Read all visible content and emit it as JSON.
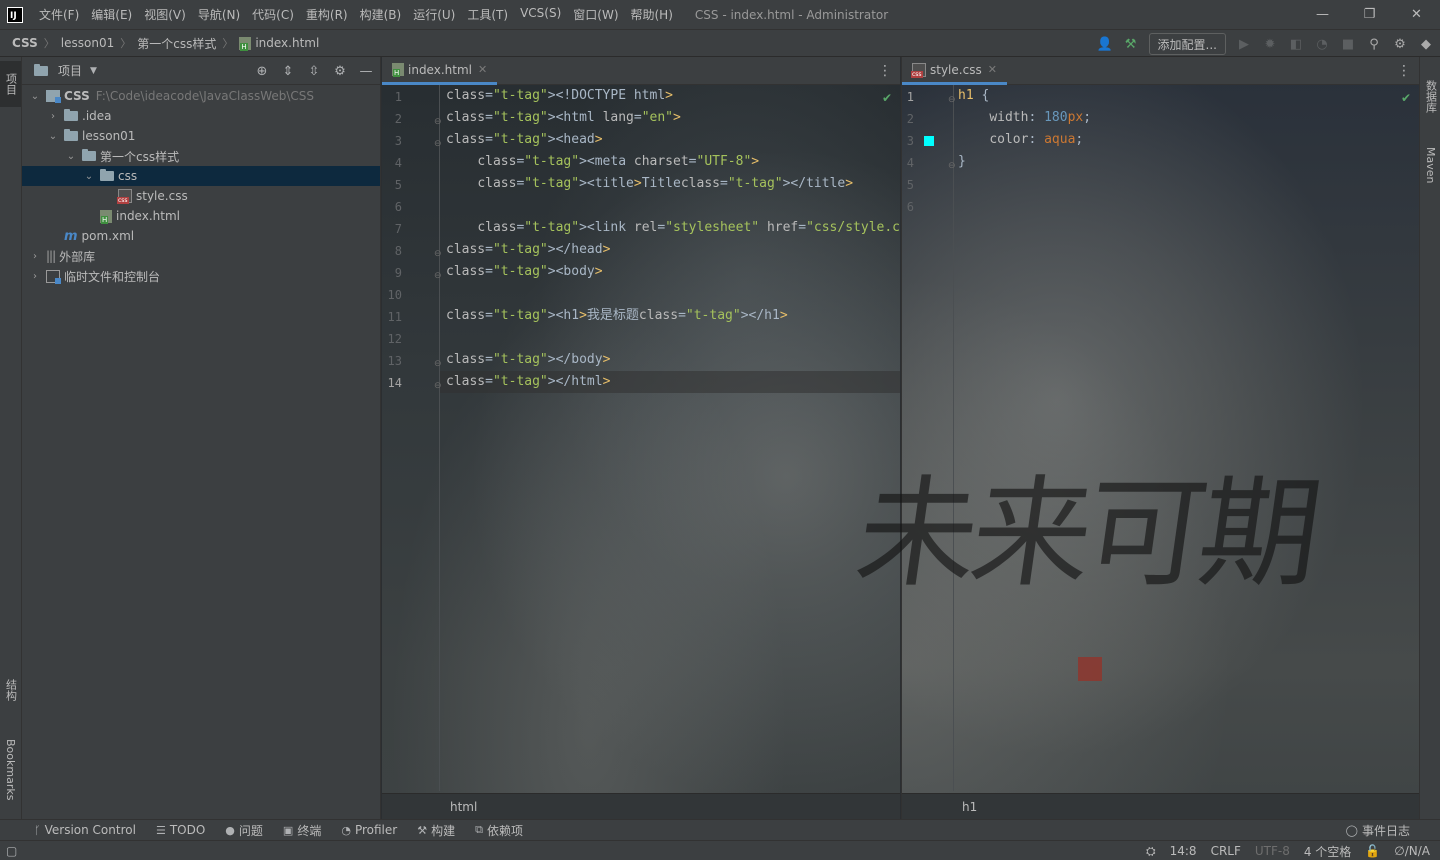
{
  "window": {
    "title": "CSS - index.html - Administrator",
    "menu": [
      "文件(F)",
      "编辑(E)",
      "视图(V)",
      "导航(N)",
      "代码(C)",
      "重构(R)",
      "构建(B)",
      "运行(U)",
      "工具(T)",
      "VCS(S)",
      "窗口(W)",
      "帮助(H)"
    ],
    "controls": {
      "minimize": "—",
      "restore": "❐",
      "close": "✕"
    }
  },
  "breadcrumb": [
    "CSS",
    "lesson01",
    "第一个css样式",
    "index.html"
  ],
  "nav_toolbar": {
    "config_button": "添加配置..."
  },
  "left_strip": {
    "project_tab": "项目",
    "structure_tab": "结构",
    "bookmarks_tab": "Bookmarks"
  },
  "right_strip": {
    "database_tab": "数据库",
    "maven_tab": "Maven"
  },
  "project_panel": {
    "title": "项目",
    "tree": [
      {
        "label": "CSS",
        "path": "F:\\Code\\ideacode\\JavaClassWeb\\CSS"
      },
      {
        "label": ".idea"
      },
      {
        "label": "lesson01"
      },
      {
        "label": "第一个css样式"
      },
      {
        "label": "css"
      },
      {
        "label": "style.css"
      },
      {
        "label": "index.html"
      },
      {
        "label": "pom.xml"
      },
      {
        "label": "外部库"
      },
      {
        "label": "临时文件和控制台"
      }
    ]
  },
  "left_editor": {
    "tab": "index.html",
    "footer": "html",
    "line_numbers": [
      "1",
      "2",
      "3",
      "4",
      "5",
      "6",
      "7",
      "8",
      "9",
      "10",
      "11",
      "12",
      "13",
      "14"
    ],
    "current_line": "14",
    "lines": [
      "<!DOCTYPE html>",
      "<html lang=\"en\">",
      "<head>",
      "    <meta charset=\"UTF-8\">",
      "    <title>Title</title>",
      "",
      "    <link rel=\"stylesheet\" href=\"css/style.css\">",
      "</head>",
      "<body>",
      "",
      "<h1>我是标题</h1>",
      "",
      "</body>",
      "</html>"
    ]
  },
  "right_editor": {
    "tab": "style.css",
    "footer": "h1",
    "line_numbers": [
      "1",
      "2",
      "3",
      "4",
      "5",
      "6"
    ],
    "lines": [
      "h1 {",
      "    width: 180px;",
      "    color: aqua;",
      "}",
      "",
      ""
    ],
    "swatch_color": "#00ffff"
  },
  "background_art": {
    "calligraphy": "未来可期"
  },
  "bottom_toolbar": {
    "items": [
      "Version Control",
      "TODO",
      "问题",
      "终端",
      "Profiler",
      "构建",
      "依赖项"
    ],
    "event_log": "事件日志"
  },
  "status_bar": {
    "position": "14:8",
    "line_sep": "CRLF",
    "encoding": "UTF-8",
    "indent": "4 个空格",
    "vcs": "∅/N/A"
  },
  "colors": {
    "accent": "#4a88c7",
    "ok": "#59a869",
    "tag": "#e8bf6a",
    "string": "#a5c25c",
    "number": "#6897bb"
  }
}
